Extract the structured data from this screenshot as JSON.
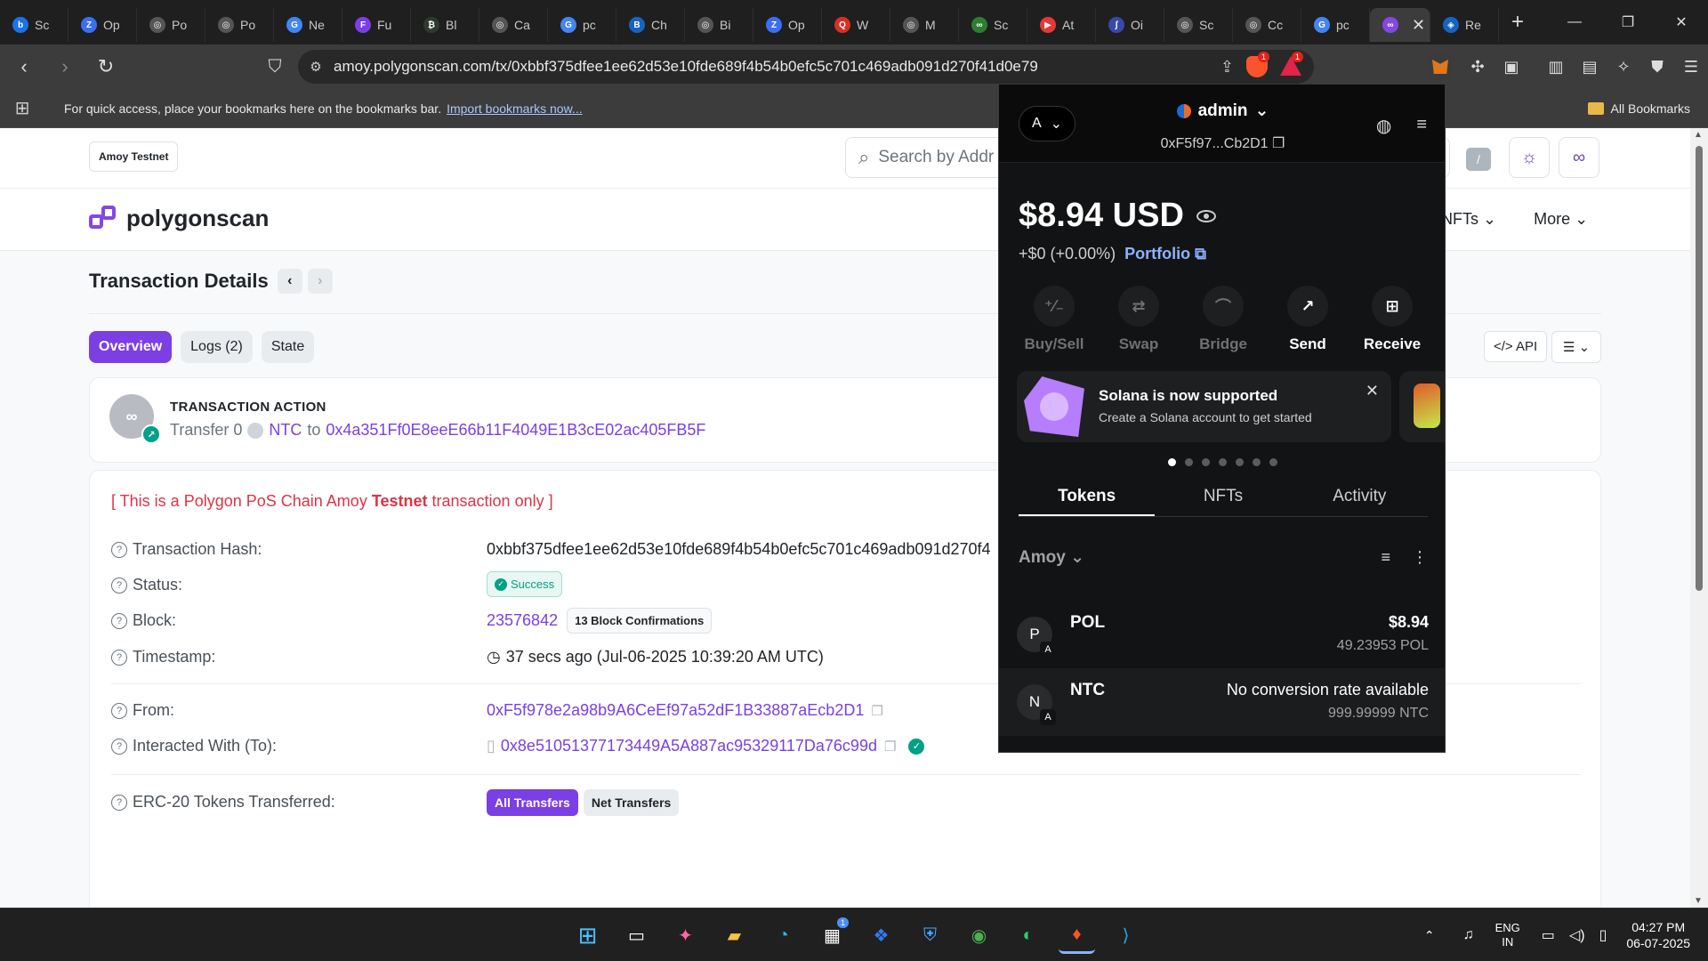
{
  "browser": {
    "tabs": [
      {
        "label": "Sc",
        "color": "#1a73e8",
        "glyph": "b"
      },
      {
        "label": "Op",
        "color": "#3b6ef5",
        "glyph": "Z"
      },
      {
        "label": "Po",
        "color": "#555555",
        "glyph": "◎"
      },
      {
        "label": "Po",
        "color": "#555555",
        "glyph": "◎"
      },
      {
        "label": "Ne",
        "color": "#4285f4",
        "glyph": "G"
      },
      {
        "label": "Fu",
        "color": "#7b3fe4",
        "glyph": "F"
      },
      {
        "label": "Bl",
        "color": "#2f3a2f",
        "glyph": "₿"
      },
      {
        "label": "Ca",
        "color": "#555555",
        "glyph": "◎"
      },
      {
        "label": "pc",
        "color": "#4285f4",
        "glyph": "G"
      },
      {
        "label": "Ch",
        "color": "#1565c0",
        "glyph": "B"
      },
      {
        "label": "Bi",
        "color": "#555555",
        "glyph": "◎"
      },
      {
        "label": "Op",
        "color": "#3b6ef5",
        "glyph": "Z"
      },
      {
        "label": "W",
        "color": "#d93025",
        "glyph": "Q"
      },
      {
        "label": "M",
        "color": "#555555",
        "glyph": "◎"
      },
      {
        "label": "Sc",
        "color": "#2e7d32",
        "glyph": "∞"
      },
      {
        "label": "At",
        "color": "#e53935",
        "glyph": "▶"
      },
      {
        "label": "Oi",
        "color": "#3949ab",
        "glyph": "ʃ"
      },
      {
        "label": "Sc",
        "color": "#555555",
        "glyph": "◎"
      },
      {
        "label": "Cc",
        "color": "#555555",
        "glyph": "◎"
      },
      {
        "label": "pc",
        "color": "#4285f4",
        "glyph": "G"
      }
    ],
    "active_tab_close": "✕",
    "extra_tab": {
      "label": "Re",
      "color": "#1565c0",
      "glyph": "◈"
    },
    "new_tab": "+",
    "url": "amoy.polygonscan.com/tx/0xbbf375dfee1ee62d53e10fde689f4b54b0efc5c701c469adb091d270f41d0e79",
    "shield_badge": "1",
    "rewards_badge": "1",
    "bookmarks_prompt": "For quick access, place your bookmarks here on the bookmarks bar.",
    "bookmarks_link": "Import bookmarks now...",
    "all_bookmarks": "All Bookmarks"
  },
  "site": {
    "network_pill": "Amoy Testnet",
    "search_placeholder": "Search by Addr",
    "slash_key": "/",
    "logo_text": "polygonscan",
    "nav": [
      "NFTs ⌄",
      "More ⌄"
    ],
    "page_title": "Transaction Details",
    "tabs": [
      "Overview",
      "Logs (2)",
      "State"
    ],
    "api_label": "</> API",
    "action_heading": "TRANSACTION ACTION",
    "action_prefix": "Transfer 0",
    "action_token": "NTC",
    "action_to_word": "to",
    "action_to_addr": "0x4a351Ff0E8eeE66b11F4049E1B3cE02ac405FB5F",
    "warning_pre": "[ This is a Polygon PoS Chain Amoy ",
    "warning_bold": "Testnet",
    "warning_post": " transaction only ]",
    "rows": {
      "hash_label": "Transaction Hash:",
      "hash_value": "0xbbf375dfee1ee62d53e10fde689f4b54b0efc5c701c469adb091d270f4",
      "status_label": "Status:",
      "status_value": "Success",
      "block_label": "Block:",
      "block_value": "23576842",
      "block_conf": "13 Block Confirmations",
      "ts_label": "Timestamp:",
      "ts_value": "37 secs ago (Jul-06-2025 10:39:20 AM UTC)",
      "from_label": "From:",
      "from_value": "0xF5f978e2a98b9A6CeEf97a52dF1B33887aEcb2D1",
      "to_label": "Interacted With (To):",
      "to_value": "0x8e51051377173449A5A887ac95329117Da76c99d",
      "erc_label": "ERC-20 Tokens Transferred:",
      "erc_all": "All Transfers",
      "erc_net": "Net Transfers"
    }
  },
  "metamask": {
    "account_initial": "A",
    "account_name": "admin",
    "address": "0xF5f97...Cb2D1",
    "balance": "$8.94 USD",
    "change": "+$0 (+0.00%)",
    "portfolio": "Portfolio",
    "actions": [
      {
        "label": "Buy/Sell",
        "icon": "⁺⁄₋",
        "enabled": false
      },
      {
        "label": "Swap",
        "icon": "⇄",
        "enabled": false
      },
      {
        "label": "Bridge",
        "icon": "⌒",
        "enabled": false
      },
      {
        "label": "Send",
        "icon": "↗",
        "enabled": true
      },
      {
        "label": "Receive",
        "icon": "⊞",
        "enabled": true
      }
    ],
    "promo_title": "Solana is now supported",
    "promo_sub": "Create a Solana account to get started",
    "tabs": [
      "Tokens",
      "NFTs",
      "Activity"
    ],
    "network": "Amoy",
    "tokens": [
      {
        "initial": "P",
        "chain": "A",
        "name": "POL",
        "value": "$8.94",
        "amount": "49.23953 POL"
      },
      {
        "initial": "N",
        "chain": "A",
        "name": "NTC",
        "value": "No conversion rate available",
        "amount": "999.99999 NTC"
      }
    ]
  },
  "taskbar": {
    "lang_top": "ENG",
    "lang_bottom": "IN",
    "time": "04:27 PM",
    "date": "06-07-2025",
    "store_badge": "1"
  }
}
